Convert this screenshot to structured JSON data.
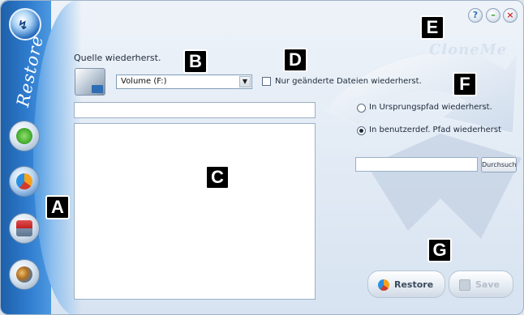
{
  "sidebar": {
    "title": "Restore",
    "items": [
      {
        "icon": "backup-icon"
      },
      {
        "icon": "restore-icon"
      },
      {
        "icon": "calendar-icon"
      },
      {
        "icon": "tools-icon"
      }
    ]
  },
  "titlebar": {
    "help_glyph": "?",
    "minimize_glyph": "–",
    "close_glyph": "×"
  },
  "watermark": "CloneMe",
  "source": {
    "label": "Quelle wiederherst.",
    "selected": "Volume (F:)",
    "only_changed_label": "Nur geänderte Dateien wiederherst.",
    "only_changed_checked": false
  },
  "destination": {
    "option_original": "In Ursprungspfad wiederherst.",
    "option_custom": "In benutzerdef. Pfad wiederherst",
    "selected": "custom",
    "custom_path": "",
    "browse_label": "Durchsuchen"
  },
  "actions": {
    "restore_label": "Restore",
    "save_label": "Save"
  },
  "markers": [
    "A",
    "B",
    "C",
    "D",
    "E",
    "F",
    "G"
  ]
}
